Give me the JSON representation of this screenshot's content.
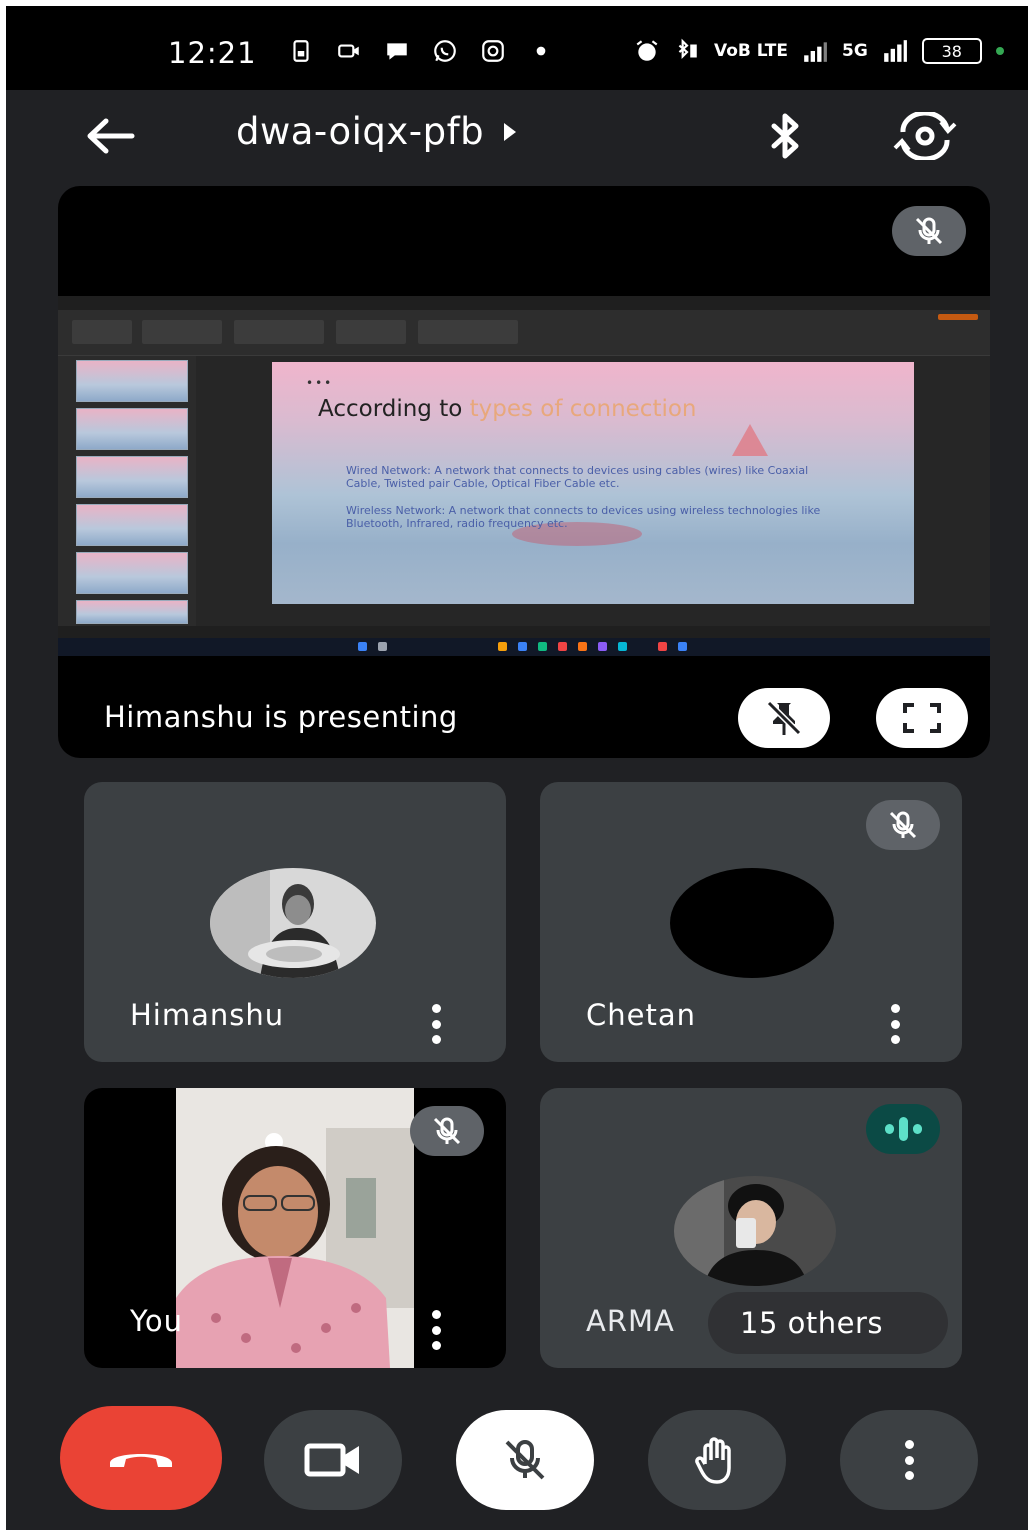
{
  "status_bar": {
    "time": "12:21",
    "network_label": "VoB LTE",
    "signal_5g_label": "5G",
    "battery": "38",
    "left_icons": [
      "sim-card-icon",
      "video-call-icon",
      "chat-icon",
      "whatsapp-icon",
      "instagram-icon",
      "dot-icon"
    ],
    "right_icons": [
      "alarm-icon",
      "bluetooth-vibrate-icon",
      "network-icon",
      "signal-icon",
      "signal-5g-icon",
      "battery-icon"
    ]
  },
  "app_bar": {
    "meeting_code": "dwa-oiqx-pfb",
    "icons": [
      "back-arrow-icon",
      "play-triangle-icon",
      "bluetooth-icon",
      "flip-camera-icon"
    ]
  },
  "presentation": {
    "presenter_label": "Himanshu is presenting",
    "slide": {
      "title_prefix": "According to",
      "title_highlight": "types of connection",
      "bullet1": "Wired Network: A network that connects to devices using cables (wires) like Coaxial Cable, Twisted pair Cable, Optical Fiber Cable etc.",
      "bullet2": "Wireless Network: A network that connects to devices using wireless technologies like Bluetooth, Infrared, radio frequency etc."
    },
    "buttons": [
      "unpin-icon",
      "fullscreen-icon"
    ]
  },
  "participants": [
    {
      "name": "Himanshu",
      "muted": false
    },
    {
      "name": "Chetan",
      "muted": true
    },
    {
      "name": "You",
      "muted": true
    },
    {
      "name": "ARMA",
      "others": "15 others",
      "speaking": true
    }
  ],
  "controls": {
    "end_call_color": "#ea4335",
    "icons": [
      "end-call-icon",
      "camera-icon",
      "mic-off-icon",
      "raise-hand-icon",
      "more-options-icon"
    ]
  },
  "colors": {
    "background": "#202124",
    "tile": "#3c4043",
    "speaking": "#5de0c8",
    "end_call": "#ea4335"
  }
}
